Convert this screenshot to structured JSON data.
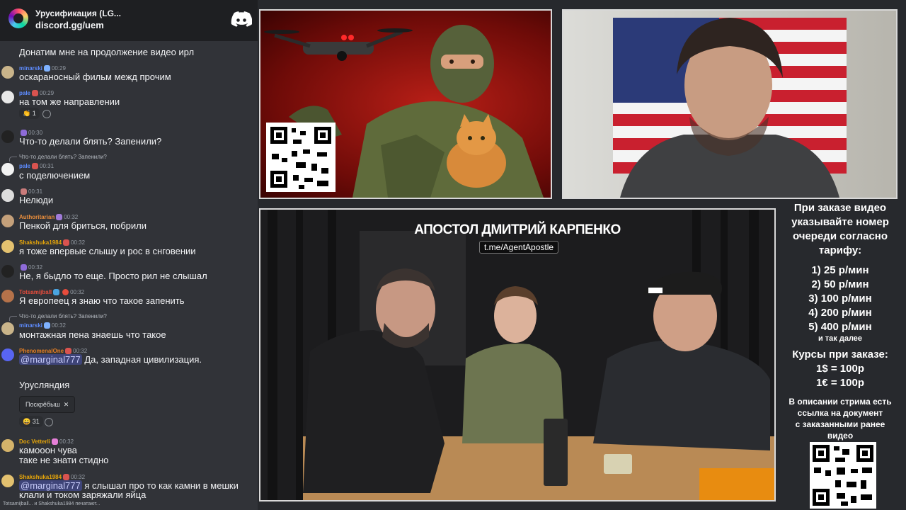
{
  "chat": {
    "server_name": "Урусификация (LG...",
    "invite_link": "discord.gg/uem",
    "top_message": "Донатим мне на продолжение видео ирл",
    "messages": [
      {
        "user": "minarski",
        "time": "00:29",
        "text": "оскараносный фильм межд прочим",
        "user_color": "#5e8cff"
      },
      {
        "user": "pale",
        "time": "00:29",
        "text": "на том же направлении",
        "user_color": "#5e8cff",
        "reaction_count": "1"
      },
      {
        "user": "",
        "time": "00:30",
        "text": "Что-то делали блять? Запенили?",
        "user_color": "#8ea26b"
      },
      {
        "user": "pale",
        "time": "00:31",
        "text": "с поделючением",
        "user_color": "#5e8cff",
        "reply": "Что-то делали блять? Запенили?"
      },
      {
        "user": "",
        "time": "00:31",
        "text": "Нелюди",
        "user_color": "#9b9b9b"
      },
      {
        "user": "Authoritarian",
        "time": "00:32",
        "text": "Пенкой для бриться, побрили",
        "user_color": "#e88d3c"
      },
      {
        "user": "Shakshuka1984",
        "time": "00:32",
        "text": "я тоже впервые слышу и рос в снговении",
        "user_color": "#e5a50a"
      },
      {
        "user": "",
        "time": "00:32",
        "text": "Не, я быдло то еще. Просто рил не слышал",
        "user_color": "#8ea26b"
      },
      {
        "user": "Totsamijball",
        "time": "00:32",
        "text": "Я европеец я знаю что такое запенить",
        "user_color": "#e74c3c"
      },
      {
        "user": "minarski",
        "time": "00:32",
        "text": "монтажная пена знаешь что такое",
        "user_color": "#5e8cff",
        "reply": "Что-то делали блять? Запенили?"
      },
      {
        "user": "PhenomenalOne",
        "time": "00:32",
        "text": "Да, западная цивилизация.",
        "mention": "@marginal777",
        "user_color": "#e67e22"
      },
      {
        "user": "",
        "time": "",
        "text": "Урусляндия",
        "user_color": "#9b9b9b",
        "attachment": "Поскрёбыш",
        "reaction_count": "31"
      },
      {
        "user": "Doc Vetterli",
        "time": "00:32",
        "text": "камооон чува",
        "text2": "таке не знати стидно",
        "user_color": "#e5a50a"
      },
      {
        "user": "Shakshuka1984",
        "time": "00:32",
        "text": "я слышал про то как камни в мешки",
        "text2": "клали и током заряжали яйца",
        "mention": "@marginal777",
        "user_color": "#e5a50a"
      }
    ],
    "typing": "Totsamijball... и Shakshuka1984 печатают..."
  },
  "poster": {
    "qr_label": ""
  },
  "studio": {
    "title": "АПОСТОЛ ДМИТРИЙ КАРПЕНКО",
    "link": "t.me/AgentApostle"
  },
  "info": {
    "heading": [
      "При заказе видео",
      "указывайте номер",
      "очереди согласно",
      "тарифу:"
    ],
    "tariffs": [
      "1) 25 р/мин",
      "2) 50 р/мин",
      "3) 100 р/мин",
      "4) 200 р/мин",
      "5) 400 р/мин"
    ],
    "etc": "и так далее",
    "rates_heading": "Курсы при заказе:",
    "rates": [
      "1$ = 100р",
      "1€ = 100р"
    ],
    "desc": [
      "В описании стрима есть",
      "ссылка на документ",
      "с заказанными ранее",
      "видео"
    ]
  },
  "colors": {
    "chat_bg": "#313338",
    "header_bg": "#1e1f22",
    "discord_blurple": "#5865f2",
    "poster_red": "#b81f17"
  }
}
